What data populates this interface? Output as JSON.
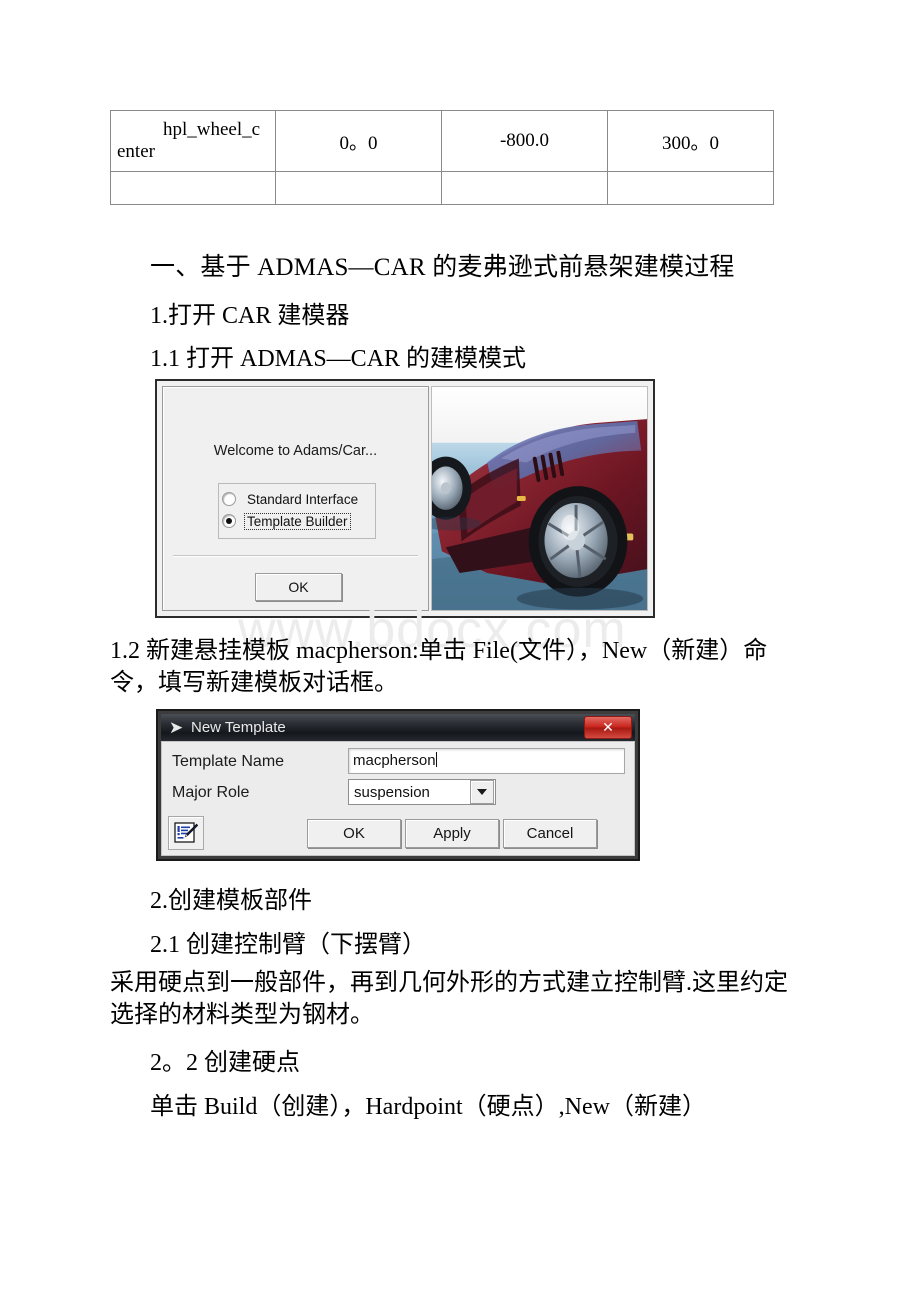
{
  "document": {
    "table": {
      "columns": 4,
      "rows": [
        {
          "name_line1": "hpl_wheel_c",
          "name_line2": "enter",
          "v1": "0。0",
          "v2": "-800.0",
          "v3": "300。0"
        },
        {
          "name_line1": "",
          "name_line2": "",
          "v1": "",
          "v2": "",
          "v3": ""
        }
      ]
    },
    "watermark": "www.bdocx.com",
    "paragraphs": {
      "heading_1": "一、基于 ADMAS—CAR 的麦弗逊式前悬架建模过程",
      "item_1": "1.打开 CAR 建模器",
      "item_1_1": "1.1 打开 ADMAS—CAR 的建模模式",
      "item_1_2": "1.2 新建悬挂模板 macpherson:单击 File(文件），New（新建）命令，填写新建模板对话框。",
      "item_2": "2.创建模板部件",
      "item_2_1": "2.1 创建控制臂（下摆臂）",
      "item_2_1_body": "采用硬点到一般部件，再到几何外形的方式建立控制臂.这里约定选择的材料类型为钢材。",
      "item_2_2": "2。2 创建硬点",
      "item_2_2_body": "单击 Build（创建），Hardpoint（硬点）,New（新建）"
    }
  },
  "screenshot_welcome": {
    "title": "Welcome to Adams/Car...",
    "radios": [
      {
        "label": "Standard Interface",
        "selected": false
      },
      {
        "label": "Template Builder",
        "selected": true
      }
    ],
    "ok_label": "OK",
    "car_image_alt": "red-sports-car-render"
  },
  "screenshot_new_template": {
    "window_title": "New Template",
    "app_icon": "adams-logo-icon",
    "close_label": "✕",
    "fields": [
      {
        "label": "Template Name",
        "value": "macpherson",
        "type": "text"
      },
      {
        "label": "Major Role",
        "value": "suspension",
        "type": "combobox"
      }
    ],
    "edit_icon": "edit-note-pen-icon",
    "buttons": [
      "OK",
      "Apply",
      "Cancel"
    ]
  },
  "colors": {
    "dialog_face": "#f0f0f0",
    "titlebar_dark": "#14171c",
    "close_red": "#c8241c",
    "watermark_gray": "#ececec",
    "table_border": "#8a8a8a"
  }
}
